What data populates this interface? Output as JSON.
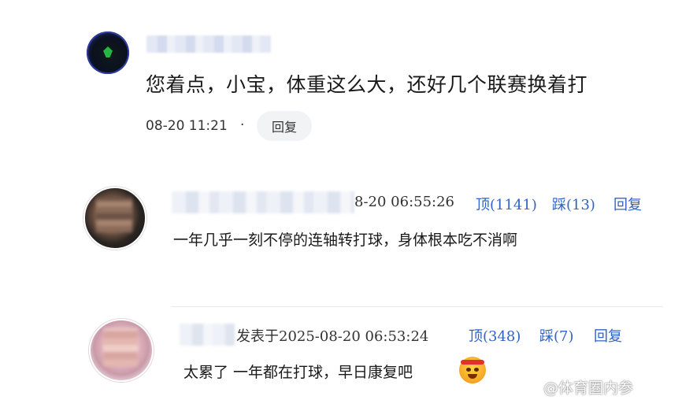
{
  "comments": [
    {
      "avatar": "gamer-logo-avatar",
      "text": "您着点，小宝，体重这么大，还好几个联赛换着打",
      "time": "08-20 11:21",
      "separator": "·",
      "reply_label": "回复"
    },
    {
      "avatar": "blurred-face-avatar",
      "time": "8-20 06:55:26",
      "up_label": "顶(1141)",
      "down_label": "踩(13)",
      "reply_label": "回复",
      "text": "一年几乎一刻不停的连轴转打球，身体根本吃不消啊"
    },
    {
      "avatar": "blurred-face-avatar",
      "time": "发表于2025-08-20 06:53:24",
      "up_label": "顶(348)",
      "down_label": "踩(7)",
      "reply_label": "回复",
      "text": "太累了 一年都在打球，早日康复吧",
      "emoji": "angry-face-headband-emoji"
    }
  ],
  "watermark": "@体育圈内参",
  "colors": {
    "action_link": "#2f63c5",
    "reply_pill_bg": "#f2f3f5",
    "text": "#1a1a1a"
  }
}
